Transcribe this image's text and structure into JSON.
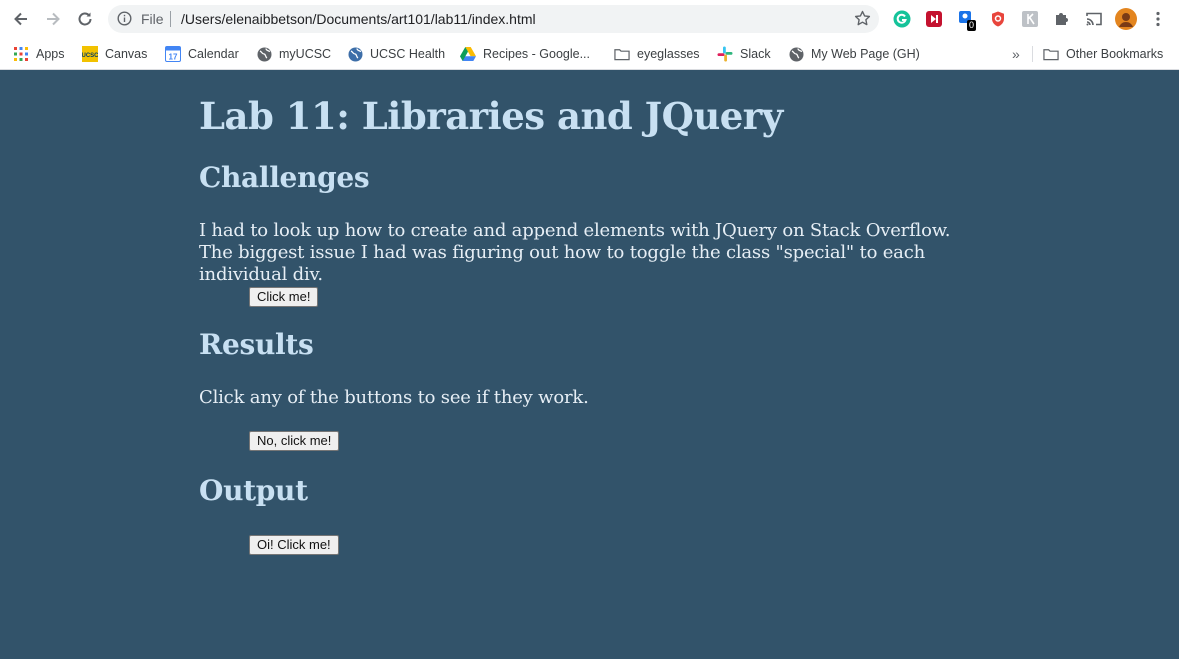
{
  "browser": {
    "scheme_label": "File",
    "url": "/Users/elenaibbetson/Documents/art101/lab11/index.html",
    "extension_badge": "0",
    "bookmarks": [
      {
        "label": "Apps",
        "icon": "apps-grid-icon"
      },
      {
        "label": "Canvas",
        "icon": "ucsc-icon"
      },
      {
        "label": "Calendar",
        "icon": "calendar-icon",
        "badge": "17"
      },
      {
        "label": "myUCSC",
        "icon": "globe-icon"
      },
      {
        "label": "UCSC Health",
        "icon": "globe-icon"
      },
      {
        "label": "Recipes - Google...",
        "icon": "google-drive-icon"
      },
      {
        "label": "eyeglasses",
        "icon": "folder-icon"
      },
      {
        "label": "Slack",
        "icon": "slack-icon"
      },
      {
        "label": "My Web Page (GH)",
        "icon": "globe-icon"
      }
    ],
    "overflow_label": "»",
    "other_bookmarks_label": "Other Bookmarks"
  },
  "page": {
    "title": "Lab 11: Libraries and JQuery",
    "challenges_heading": "Challenges",
    "challenges_text": "I had to look up how to create and append elements with JQuery on Stack Overflow. The biggest issue I had was figuring out how to toggle the class \"special\" to each individual div.",
    "button_1": "Click me!",
    "results_heading": "Results",
    "results_text": "Click any of the buttons to see if they work.",
    "button_2": "No, click me!",
    "output_heading": "Output",
    "button_3": "Oi! Click me!"
  },
  "colors": {
    "page_background": "#32536a",
    "heading_text": "#c8e0f2",
    "body_text": "#e6eef5"
  }
}
